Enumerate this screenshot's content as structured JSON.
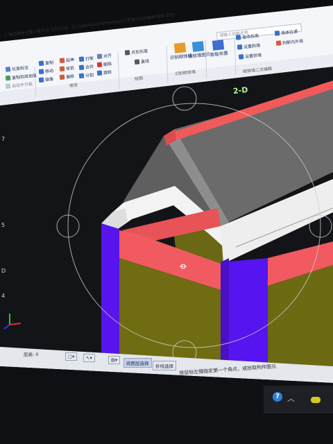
{
  "app": {
    "title": "广联达BIM土建计量平台 GTJ2018 - [C:\\Users\\user\\Desktop\\(江苏泰山站)\\墙体\\构件.GTJ]"
  },
  "ribbon": {
    "search_placeholder": "请输入功能名称",
    "left_group": {
      "items": [
        "长度标注",
        "复制到其他层",
        "自动平齐板"
      ]
    },
    "modify_group": {
      "label": "修改",
      "items": [
        "复制",
        "移动",
        "镜像",
        "延伸",
        "修剪",
        "偏移",
        "打断",
        "合并",
        "分割",
        "对齐",
        "删除",
        "旋转"
      ]
    },
    "draw_group": {
      "label": "绘图",
      "items": [
        "直线",
        "点加长度"
      ]
    },
    "identify_group": {
      "label": "识别砌体墙",
      "items": [
        "识别砌体墙",
        "校核墙图元"
      ]
    },
    "smart_group": {
      "items": [
        "智能布置"
      ]
    },
    "wall_edit_group": {
      "label": "砌体墙二次编辑",
      "items": [
        "查改标高",
        "设置斜墙",
        "设置拱墙",
        "墙体拉通",
        "判断内外墙"
      ]
    }
  },
  "viewport": {
    "compass_label": "2-D",
    "axis_labels": [
      "7",
      "5",
      "D",
      "4"
    ],
    "background": "#131417",
    "colors": {
      "column": "#5b16f0",
      "beam": "#f0565e",
      "wall": "#6f6c12",
      "slab_top": "#f2f2f2",
      "roof": "#6b6b6b",
      "ridge": "#f25858"
    }
  },
  "status_bar": {
    "floor_height_label": "层高: 0",
    "select_modes": [
      "跨图层选择",
      "折线选择"
    ],
    "prompt": "按鼠标左键指定第一个角点，或拾取构件图元"
  },
  "taskbar": {
    "icons": [
      "help-icon",
      "chevron-up-icon",
      "tray-app-icon"
    ]
  }
}
